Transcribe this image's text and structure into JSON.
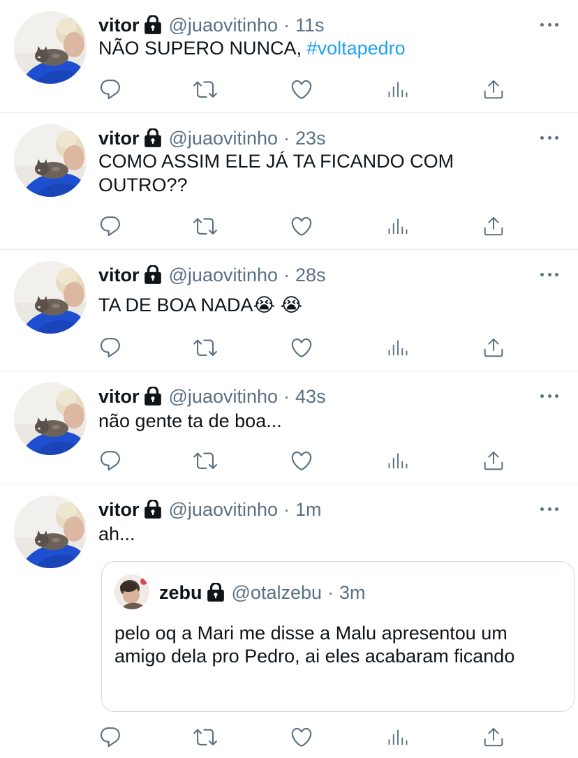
{
  "tweets": [
    {
      "name": "vitor",
      "handle": "@juaovitinho",
      "separator": "·",
      "time": "11s",
      "text": "NÃO SUPERO NUNCA, ",
      "hashtag": "#voltapedro"
    },
    {
      "name": "vitor",
      "handle": "@juaovitinho",
      "separator": "·",
      "time": "23s",
      "text": "COMO ASSIM ELE JÁ TA FICANDO COM OUTRO??"
    },
    {
      "name": "vitor",
      "handle": "@juaovitinho",
      "separator": "·",
      "time": "28s",
      "text": "TA DE BOA NADA😭 😭"
    },
    {
      "name": "vitor",
      "handle": "@juaovitinho",
      "separator": "·",
      "time": "43s",
      "text": "não gente ta de boa..."
    },
    {
      "name": "vitor",
      "handle": "@juaovitinho",
      "separator": "·",
      "time": "1m",
      "text": "ah...",
      "quote": {
        "name": "zebu",
        "handle": "@otalzebu",
        "separator": "·",
        "time": "3m",
        "text": "pelo oq a Mari me disse a Malu apresentou um amigo dela pro Pedro, ai eles acabaram ficando"
      }
    }
  ],
  "icons": {
    "reply": "reply-icon",
    "retweet": "retweet-icon",
    "like": "heart-icon",
    "analytics": "analytics-icon",
    "share": "share-icon",
    "more": "more-icon",
    "lock": "lock-icon"
  },
  "colors": {
    "text": "#0f1419",
    "secondary": "#5b7083",
    "hashtag": "#1da1f2",
    "divider": "#e6ecf0"
  }
}
